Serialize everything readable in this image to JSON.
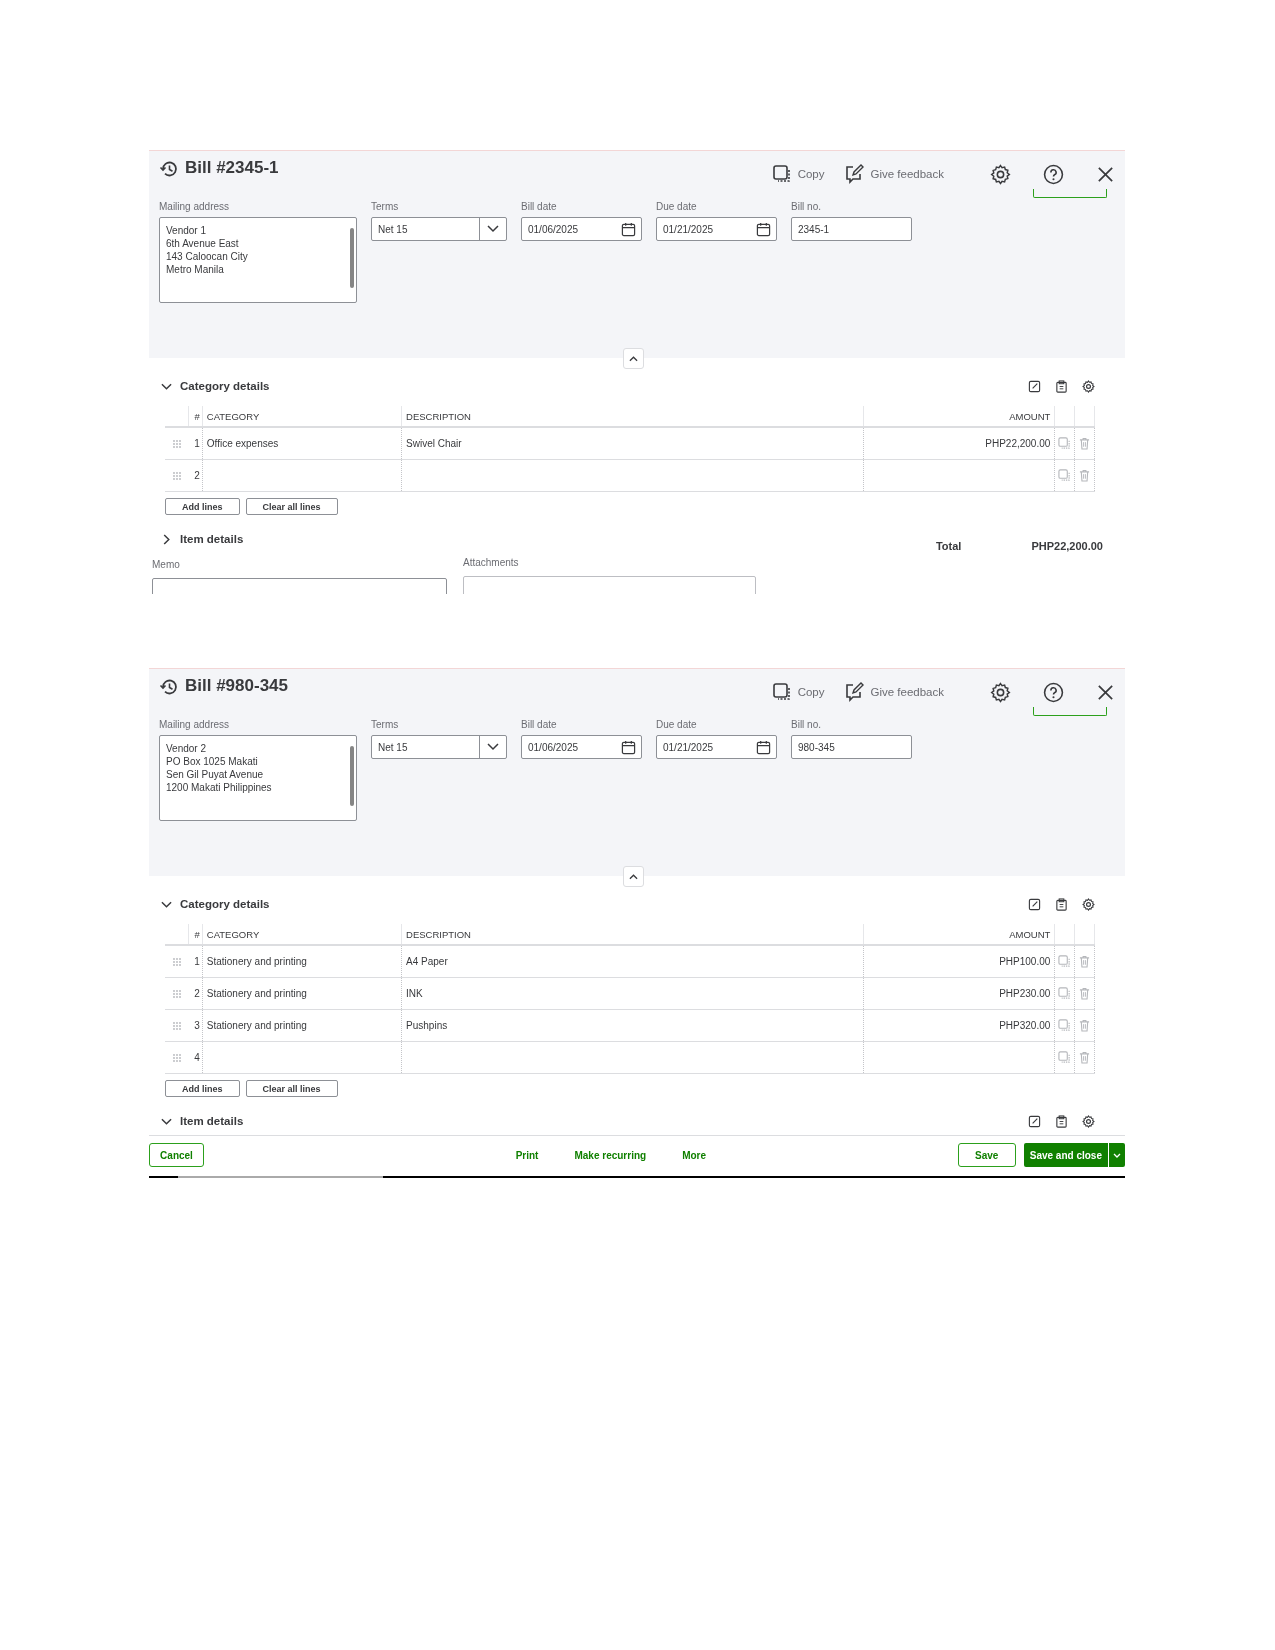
{
  "bills": [
    {
      "title": "Bill #2345-1",
      "header_actions": [
        {
          "kind": "copy",
          "label": "Copy"
        },
        {
          "kind": "feedback",
          "label": "Give feedback"
        }
      ],
      "fields": {
        "mailing_address_label": "Mailing address",
        "mailing_address": [
          "Vendor 1",
          "6th Avenue East",
          "143 Caloocan City",
          "Metro Manila"
        ],
        "terms_label": "Terms",
        "terms": "Net 15",
        "bill_date_label": "Bill date",
        "bill_date": "01/06/2025",
        "due_date_label": "Due date",
        "due_date": "01/21/2025",
        "bill_no_label": "Bill no.",
        "bill_no": "2345-1"
      },
      "category_details": {
        "title": "Category details",
        "expanded": true,
        "columns": [
          "#",
          "CATEGORY",
          "DESCRIPTION",
          "AMOUNT"
        ],
        "rows": [
          {
            "number": "1",
            "category": "Office expenses",
            "description": "Swivel Chair",
            "amount": "PHP22,200.00"
          },
          {
            "number": "2"
          }
        ],
        "buttons": [
          "Add lines",
          "Clear all lines"
        ]
      },
      "item_details": {
        "title": "Item details",
        "expanded": false
      },
      "total": {
        "label": "Total",
        "value": "PHP22,200.00"
      },
      "memo": {
        "label": "Memo"
      },
      "attachments": {
        "label": "Attachments"
      }
    },
    {
      "title": "Bill #980-345",
      "header_actions": [
        {
          "kind": "copy",
          "label": "Copy"
        },
        {
          "kind": "feedback",
          "label": "Give feedback"
        }
      ],
      "fields": {
        "mailing_address_label": "Mailing address",
        "mailing_address": [
          "Vendor 2",
          "PO Box 1025 Makati",
          "Sen Gil Puyat Avenue",
          "1200 Makati Philippines"
        ],
        "terms_label": "Terms",
        "terms": "Net 15",
        "bill_date_label": "Bill date",
        "bill_date": "01/06/2025",
        "due_date_label": "Due date",
        "due_date": "01/21/2025",
        "bill_no_label": "Bill no.",
        "bill_no": "980-345"
      },
      "category_details": {
        "title": "Category details",
        "expanded": true,
        "columns": [
          "#",
          "CATEGORY",
          "DESCRIPTION",
          "AMOUNT"
        ],
        "rows": [
          {
            "number": "1",
            "category": "Stationery and printing",
            "description": "A4 Paper",
            "amount": "PHP100.00"
          },
          {
            "number": "2",
            "category": "Stationery and printing",
            "description": "INK",
            "amount": "PHP230.00"
          },
          {
            "number": "3",
            "category": "Stationery and printing",
            "description": "Pushpins",
            "amount": "PHP320.00"
          },
          {
            "number": "4"
          }
        ],
        "buttons": [
          "Add lines",
          "Clear all lines"
        ]
      },
      "item_details": {
        "title": "Item details",
        "expanded": true
      },
      "footer": {
        "cancel": "Cancel",
        "links": [
          "Print",
          "Make recurring",
          "More"
        ],
        "save": "Save",
        "save_and_close": "Save and close"
      }
    }
  ]
}
